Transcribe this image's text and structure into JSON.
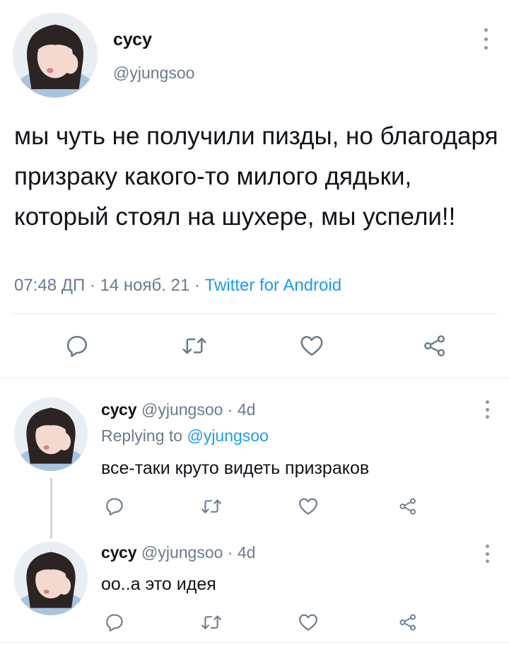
{
  "main_tweet": {
    "display_name": "сусу",
    "handle": "@yjungsoo",
    "text": "мы чуть не получили пизды, но благодаря призраку какого-то милого дядьки, который стоял на шухере, мы успели!!",
    "time": "07:48 ДП",
    "date": "14 нояб. 21",
    "source": "Twitter for Android",
    "separator": " · "
  },
  "replies": [
    {
      "display_name": "сусу",
      "handle": "@yjungsoo",
      "age": "· 4d",
      "replying_prefix": "Replying to",
      "replying_handle": "@yjungsoo",
      "text": "все-таки круто видеть призраков"
    },
    {
      "display_name": "сусу",
      "handle": "@yjungsoo",
      "age": "· 4d",
      "text": "оо..а это идея"
    }
  ],
  "icons": {
    "reply": "reply-bubble-icon",
    "retweet": "retweet-arrows-icon",
    "like": "heart-icon",
    "share": "share-nodes-icon",
    "menu": "vertical-dots-icon"
  },
  "colors": {
    "text": "#0f1419",
    "secondary": "#6b7b8a",
    "link": "#1d9bf0",
    "icon": "#6b7b8a",
    "divider": "#e6ecf0"
  }
}
